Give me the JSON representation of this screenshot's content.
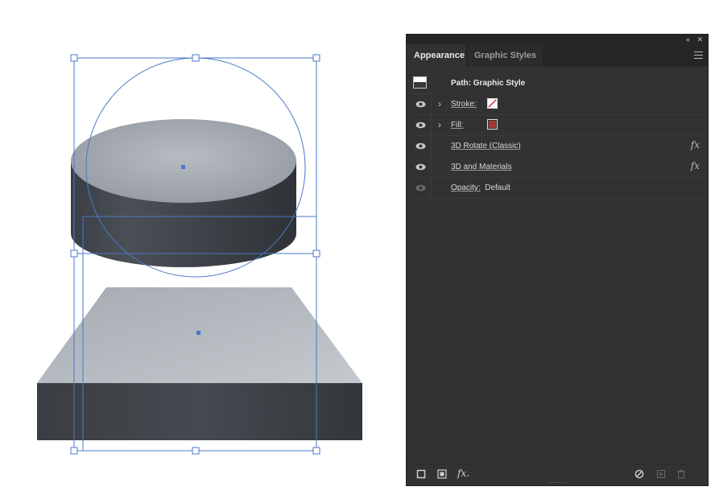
{
  "panel": {
    "tabs": [
      {
        "label": "Appearance",
        "active": true
      },
      {
        "label": "Graphic Styles",
        "active": false
      }
    ],
    "topbar": {
      "collapse_glyph": "«",
      "close_glyph": "✕"
    },
    "header": {
      "title": "Path: Graphic Style"
    },
    "rows": [
      {
        "label": "Stroke:",
        "swatch": "none-stroke",
        "expandable": true
      },
      {
        "label": "Fill:",
        "swatch_color": "#a33a32",
        "expandable": true
      },
      {
        "label": "3D Rotate (Classic)",
        "fx": "fx"
      },
      {
        "label": "3D and Materials",
        "fx": "fx"
      },
      {
        "label": "Opacity:",
        "value": "Default"
      }
    ],
    "footer": {
      "fx_label": "fx."
    }
  },
  "colors": {
    "panel_bg": "#323232",
    "tab_bar": "#262626",
    "selection_blue": "#4a78c8",
    "fill_swatch": "#a33a32",
    "stroke_slash": "#d0262c"
  },
  "artwork": {
    "objects": [
      "cylinder",
      "slab"
    ]
  }
}
